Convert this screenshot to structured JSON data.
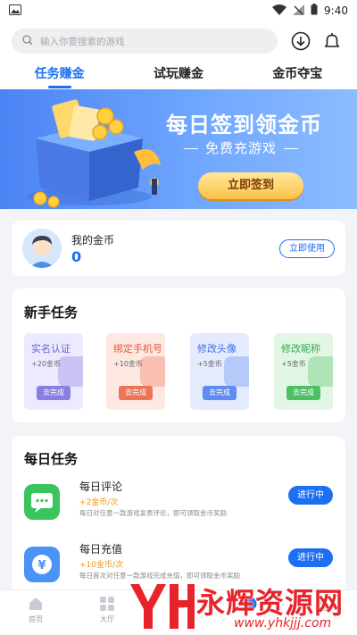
{
  "status_bar": {
    "time": "9:40"
  },
  "search": {
    "placeholder": "输入你要搜索的游戏"
  },
  "tabs": [
    {
      "label": "任务赚金",
      "active": true
    },
    {
      "label": "试玩赚金",
      "active": false
    },
    {
      "label": "金币夺宝",
      "active": false
    }
  ],
  "banner": {
    "title": "每日签到领金币",
    "subtitle": "免费充游戏",
    "button": "立即签到"
  },
  "coins": {
    "label": "我的金币",
    "value": "0",
    "button": "立即使用"
  },
  "newbie": {
    "title": "新手任务",
    "tasks": [
      {
        "title": "实名认证",
        "reward": "+20金币",
        "button": "去完成",
        "bg": "#eceafe",
        "title_color": "#6a5fd8",
        "btn_color": "#8a7fe0"
      },
      {
        "title": "绑定手机号",
        "reward": "+10金币",
        "button": "去完成",
        "bg": "#fde9e2",
        "title_color": "#e5553a",
        "btn_color": "#ee7458"
      },
      {
        "title": "修改头像",
        "reward": "+5金币",
        "button": "去完成",
        "bg": "#e3ebfd",
        "title_color": "#3e70e8",
        "btn_color": "#5f8cf0"
      },
      {
        "title": "修改昵称",
        "reward": "+5金币",
        "button": "去完成",
        "bg": "#e2f6e5",
        "title_color": "#38a94e",
        "btn_color": "#4fbf63"
      }
    ]
  },
  "daily": {
    "title": "每日任务",
    "tasks": [
      {
        "title": "每日评论",
        "reward": "+2金币/次",
        "desc": "每日对任意一款游戏发表评论，即可领取金币奖励",
        "button": "进行中",
        "icon": "chat-icon",
        "icon_color": "#3bc45c"
      },
      {
        "title": "每日充值",
        "reward": "+10金币/次",
        "desc": "每日首次对任意一款游戏完成充值，即可领取金币奖励",
        "button": "进行中",
        "icon": "yuan-icon",
        "icon_color": "#4a92f5"
      }
    ]
  },
  "bottom_nav": [
    {
      "label": "首页",
      "icon": "home-icon"
    },
    {
      "label": "大厅",
      "icon": "grid-icon"
    },
    {
      "label": "",
      "icon": "game-icon"
    },
    {
      "label": "",
      "icon": "earn-icon",
      "active": true
    },
    {
      "label": "",
      "icon": "user-icon"
    }
  ],
  "watermark": {
    "text": "永辉资源网",
    "url": "www.yhkjjj.com"
  }
}
